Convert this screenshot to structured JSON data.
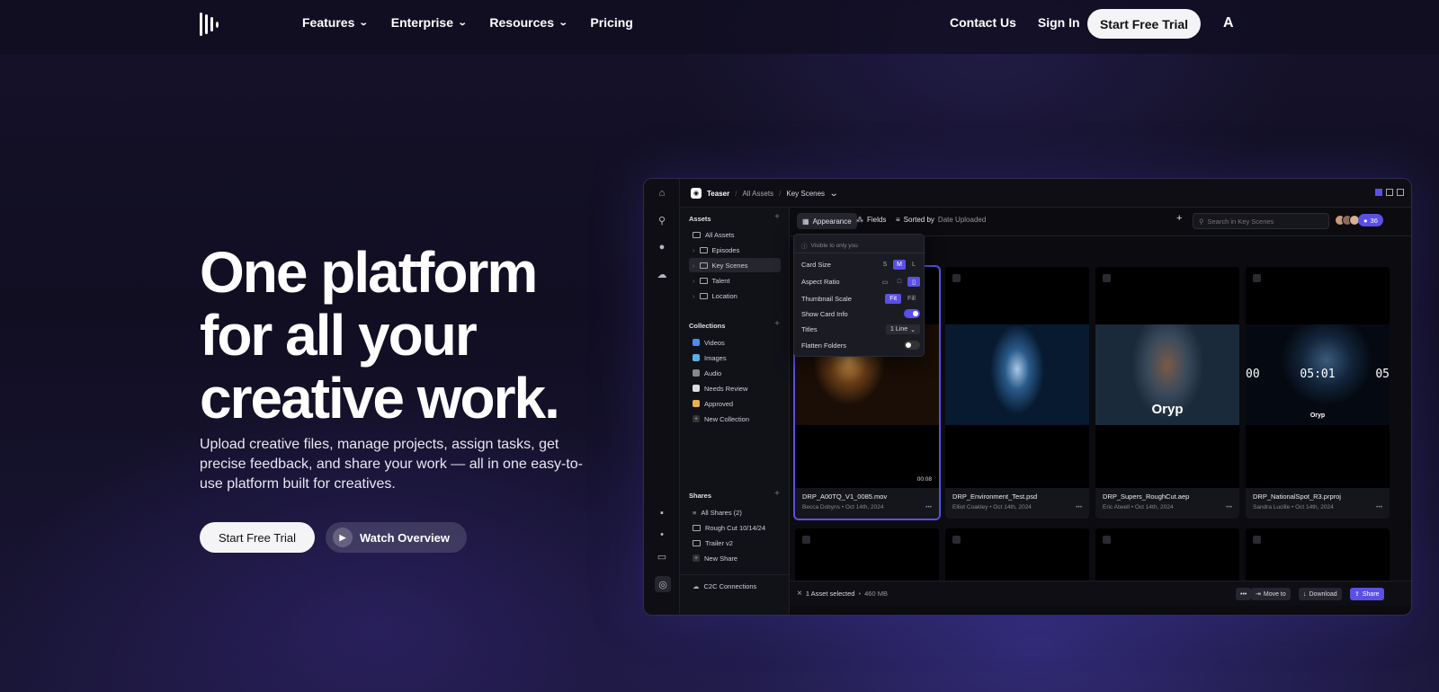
{
  "nav": {
    "links": [
      "Features",
      "Enterprise",
      "Resources",
      "Pricing"
    ],
    "contact": "Contact Us",
    "sign_in": "Sign In",
    "cta": "Start Free Trial",
    "adobe_mark": "A"
  },
  "hero": {
    "title_line1": "One platform",
    "title_line2": "for all your",
    "title_line3": "creative work.",
    "subtitle": "Upload creative files, manage projects, assign tasks, get precise feedback, and share your work — all in one easy-to-use platform built for creatives.",
    "primary_cta": "Start Free Trial",
    "secondary_cta": "Watch Overview"
  },
  "app": {
    "breadcrumb": [
      "Teaser",
      "All Assets",
      "Key Scenes"
    ],
    "sidebar": {
      "assets_title": "Assets",
      "assets": [
        "All Assets",
        "Episodes",
        "Key Scenes",
        "Talent",
        "Location"
      ],
      "collections_title": "Collections",
      "collections": [
        "Videos",
        "Images",
        "Audio",
        "Needs Review",
        "Approved",
        "New Collection"
      ],
      "shares_title": "Shares",
      "shares": [
        "All Shares (2)",
        "Rough Cut 10/14/24",
        "Trailer v2",
        "New Share"
      ],
      "c2c": "C2C Connections"
    },
    "toolbar": {
      "appearance": "Appearance",
      "fields": "Fields",
      "sorted_by": "Sorted by",
      "sort_value": "Date Uploaded",
      "search_placeholder": "Search in Key Scenes",
      "member_count": "36"
    },
    "popover": {
      "visibility": "Visible to only you",
      "card_size": "Card Size",
      "card_size_options": [
        "S",
        "M",
        "L"
      ],
      "aspect_ratio": "Aspect Ratio",
      "thumbnail_scale": "Thumbnail Scale",
      "scale_fit": "Fit",
      "scale_fill": "Fill",
      "show_card_info": "Show Card Info",
      "titles": "Titles",
      "titles_value": "1 Line",
      "flatten_folders": "Flatten Folders"
    },
    "cards": [
      {
        "file": "DRP_A00TQ_V1_0085.mov",
        "author": "Becca Dobyns",
        "date": "Oct 14th, 2024",
        "duration": "00:08"
      },
      {
        "file": "DRP_Environment_Test.psd",
        "author": "Elliot Coakley",
        "date": "Oct 14th, 2024"
      },
      {
        "file": "DRP_Supers_RoughCut.aep",
        "author": "Eric Atwell",
        "date": "Oct 14th, 2024",
        "brand": "Oryp"
      },
      {
        "file": "DRP_NationalSpot_R3.prproj",
        "author": "Sandra Lucille",
        "date": "Oct 14th, 2024",
        "timecode_left": "00",
        "timecode_mid": "05:01",
        "timecode_right": "05",
        "brand": "Oryp"
      }
    ],
    "bottombar": {
      "selected": "1 Asset selected",
      "size": "460 MB",
      "move_to": "Move to",
      "download": "Download",
      "share": "Share",
      "more": "•••"
    }
  },
  "colors": {
    "accent": "#5b50e6"
  }
}
